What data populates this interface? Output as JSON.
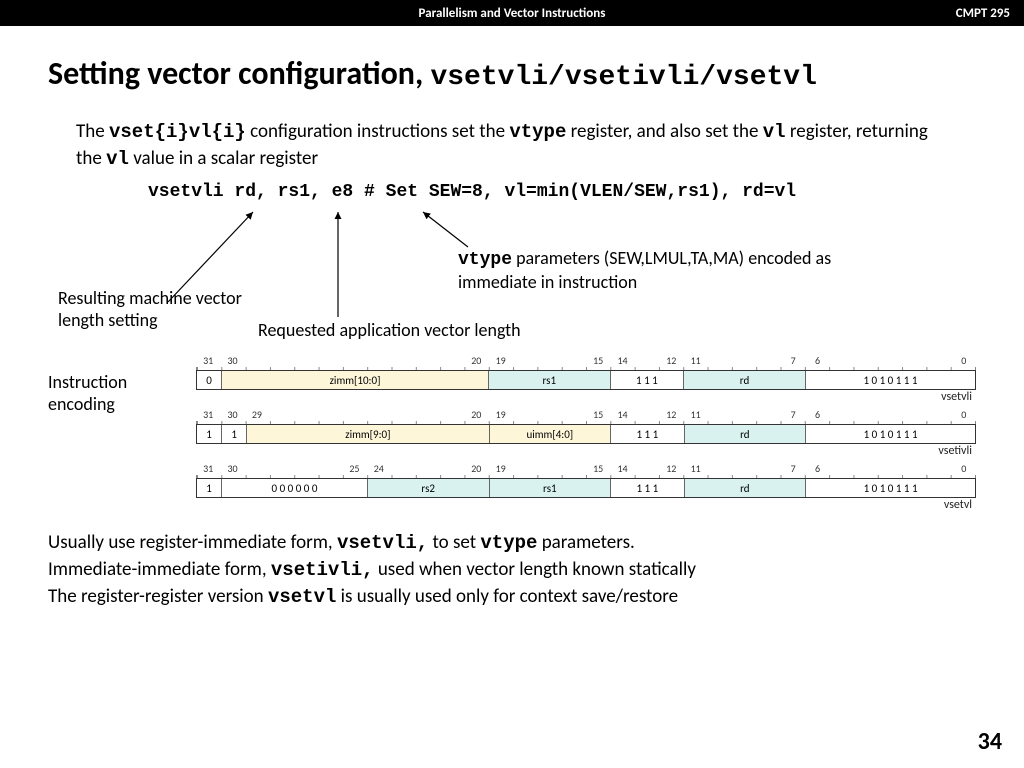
{
  "header": {
    "title": "Parallelism and Vector Instructions",
    "course": "CMPT 295"
  },
  "slide": {
    "title_prefix": "Setting vector configuration, ",
    "title_mono": "vsetvli/vsetivli/vsetvl",
    "intro_html": "The <span class='mono'>vset{i}vl{i}</span> configuration instructions set the <span class='mono'>vtype</span> register, and also set the <span class='mono'>vl</span> register, returning the <span class='mono'>vl</span> value in a scalar register",
    "code": "vsetvli rd, rs1, e8 # Set SEW=8, vl=min(VLEN/SEW,rs1), rd=vl",
    "annot_rd": "Resulting machine vector length setting",
    "annot_rs1": "Requested application vector length",
    "annot_e8_html": "<span class='mono'>vtype</span> parameters (SEW,LMUL,TA,MA) encoded as immediate in instruction",
    "side_label": "Instruction encoding",
    "footer_html": "Usually use register-immediate form, <span class='mono'>vsetvli,</span> to set <span class='mono'>vtype</span> parameters.<br>Immediate-immediate form, <span class='mono'>vsetivli,</span> used when vector length known statically<br>The register-register version <span class='mono'>vsetvl</span> is usually used only for context save/restore",
    "page": "34"
  },
  "encodings": [
    {
      "name": "vsetvli",
      "topbits": [
        "31",
        "30",
        "",
        "",
        "",
        "",
        "",
        "",
        "",
        "",
        "",
        "20",
        "19",
        "",
        "",
        "",
        "15",
        "14",
        "",
        "12",
        "11",
        "",
        "",
        "",
        "7",
        "6",
        "",
        "",
        "",
        "",
        "",
        "0"
      ],
      "fields": [
        {
          "w": 1,
          "cls": "white",
          "txt": "0"
        },
        {
          "w": 11,
          "cls": "yellow",
          "txt": "zimm[10:0]"
        },
        {
          "w": 5,
          "cls": "cyan",
          "txt": "rs1"
        },
        {
          "w": 3,
          "cls": "white",
          "txt": "1   1   1"
        },
        {
          "w": 5,
          "cls": "cyan",
          "txt": "rd"
        },
        {
          "w": 7,
          "cls": "white",
          "txt": "1   0   1   0   1   1   1"
        }
      ]
    },
    {
      "name": "vsetivli",
      "topbits": [
        "31",
        "30",
        "29",
        "",
        "",
        "",
        "",
        "",
        "",
        "",
        "",
        "20",
        "19",
        "",
        "",
        "",
        "15",
        "14",
        "",
        "12",
        "11",
        "",
        "",
        "",
        "7",
        "6",
        "",
        "",
        "",
        "",
        "",
        "0"
      ],
      "fields": [
        {
          "w": 1,
          "cls": "white",
          "txt": "1"
        },
        {
          "w": 1,
          "cls": "white",
          "txt": "1"
        },
        {
          "w": 10,
          "cls": "yellow",
          "txt": "zimm[9:0]"
        },
        {
          "w": 5,
          "cls": "yellow",
          "txt": "uimm[4:0]"
        },
        {
          "w": 3,
          "cls": "white",
          "txt": "1   1   1"
        },
        {
          "w": 5,
          "cls": "cyan",
          "txt": "rd"
        },
        {
          "w": 7,
          "cls": "white",
          "txt": "1   0   1   0   1   1   1"
        }
      ]
    },
    {
      "name": "vsetvl",
      "topbits": [
        "31",
        "30",
        "",
        "",
        "",
        "",
        "25",
        "24",
        "",
        "",
        "",
        "20",
        "19",
        "",
        "",
        "",
        "15",
        "14",
        "",
        "12",
        "11",
        "",
        "",
        "",
        "7",
        "6",
        "",
        "",
        "",
        "",
        "",
        "0"
      ],
      "fields": [
        {
          "w": 1,
          "cls": "white",
          "txt": "1"
        },
        {
          "w": 6,
          "cls": "white",
          "txt": "0   0   0   0   0   0"
        },
        {
          "w": 5,
          "cls": "cyan",
          "txt": "rs2"
        },
        {
          "w": 5,
          "cls": "cyan",
          "txt": "rs1"
        },
        {
          "w": 3,
          "cls": "white",
          "txt": "1   1   1"
        },
        {
          "w": 5,
          "cls": "cyan",
          "txt": "rd"
        },
        {
          "w": 7,
          "cls": "white",
          "txt": "1   0   1   0   1   1   1"
        }
      ]
    }
  ]
}
